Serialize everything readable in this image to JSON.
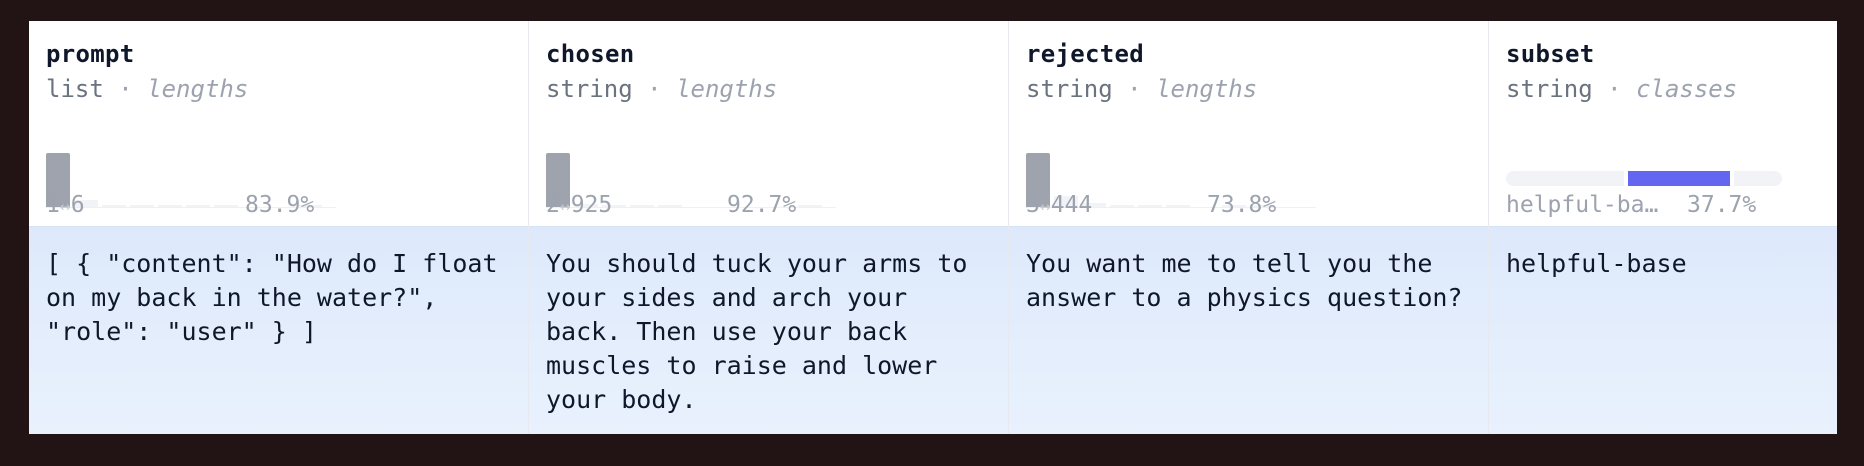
{
  "columns": [
    {
      "name": "prompt",
      "type": "list",
      "stat": "lengths",
      "range_min": "1",
      "range_max": "6",
      "percent": "83.9%",
      "cell": "[ { \"content\": \"How do I float\non my back in the water?\",\n\"role\": \"user\" } ]"
    },
    {
      "name": "chosen",
      "type": "string",
      "stat": "lengths",
      "range_min": "2",
      "range_max": "925",
      "percent": "92.7%",
      "cell": "You should tuck your arms to\nyour sides and arch your\nback. Then use your back\nmuscles to raise and lower\nyour body."
    },
    {
      "name": "rejected",
      "type": "string",
      "stat": "lengths",
      "range_min": "3",
      "range_max": "444",
      "percent": "73.8%",
      "cell": "You want me to tell you the\nanswer to a physics question?"
    },
    {
      "name": "subset",
      "type": "string",
      "stat": "classes",
      "class_label": "helpful-ba…",
      "percent": "37.7%",
      "cell": "helpful-base",
      "class_share": 0.377
    }
  ],
  "colors": {
    "class_highlight": "#6366f1",
    "class_track": "#f1f3f6",
    "hist_main": "#9ea3ad"
  }
}
